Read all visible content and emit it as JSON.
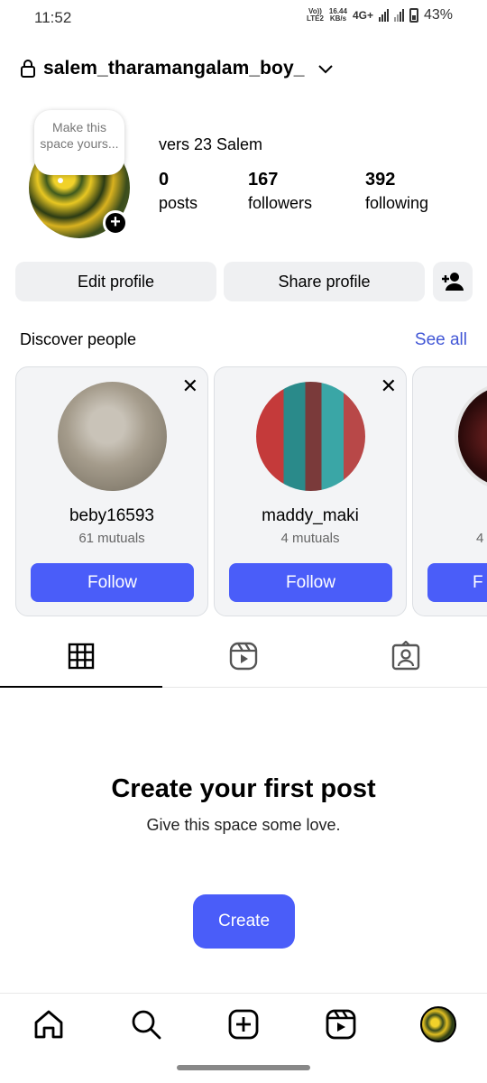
{
  "status_bar": {
    "time": "11:52",
    "volte": "Vo))\nLTE2",
    "speed_top": "16.44",
    "speed_bottom": "KB/s",
    "network": "4G+",
    "battery": "43%"
  },
  "header": {
    "username": "salem_tharamangalam_boy_"
  },
  "profile": {
    "note": "Make this space yours...",
    "display_name": "vers 23 Salem",
    "stats": [
      {
        "value": "0",
        "label": "posts"
      },
      {
        "value": "167",
        "label": "followers"
      },
      {
        "value": "392",
        "label": "following"
      }
    ]
  },
  "actions": {
    "edit_label": "Edit profile",
    "share_label": "Share profile"
  },
  "discover": {
    "title": "Discover people",
    "see_all": "See all",
    "cards": [
      {
        "name": "beby16593",
        "mutuals": "61 mutuals",
        "follow": "Follow"
      },
      {
        "name": "maddy_maki",
        "mutuals": "4 mutuals",
        "follow": "Follow"
      },
      {
        "name": "",
        "mutuals": "4",
        "follow": "F"
      }
    ]
  },
  "empty_state": {
    "title": "Create your first post",
    "subtitle": "Give this space some love.",
    "button": "Create"
  },
  "colors": {
    "accent": "#4a5df9",
    "link": "#4257d6",
    "button_gray": "#eff0f2"
  },
  "icons": {
    "tabs": [
      "grid-icon",
      "reels-icon",
      "tagged-icon"
    ],
    "nav": [
      "home-icon",
      "search-icon",
      "add-post-icon",
      "reels-icon",
      "profile-avatar"
    ]
  }
}
